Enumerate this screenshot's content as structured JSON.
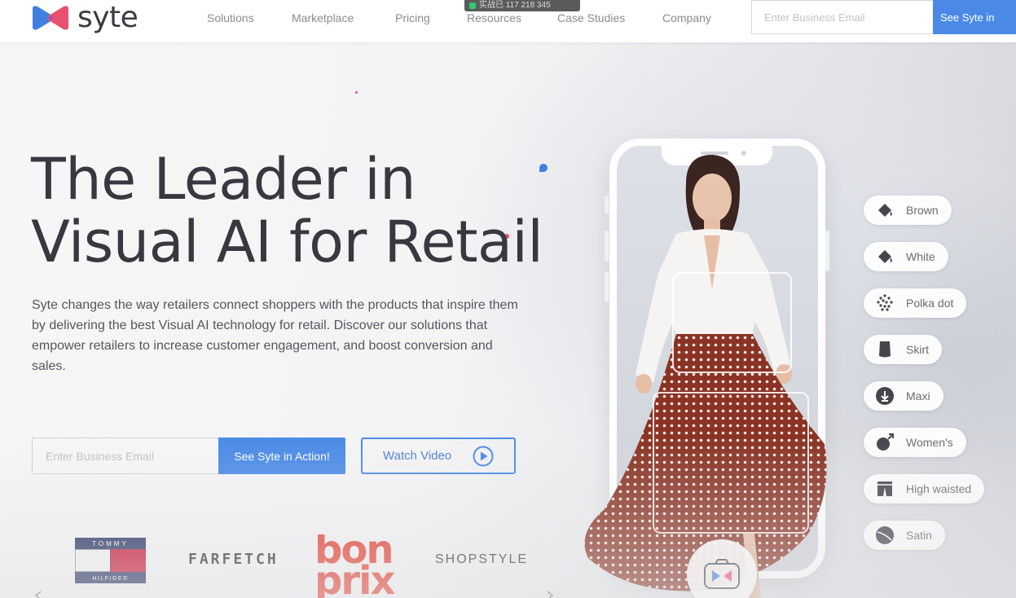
{
  "header": {
    "logo_text": "syte",
    "nav": [
      {
        "label": "Solutions"
      },
      {
        "label": "Marketplace"
      },
      {
        "label": "Pricing"
      },
      {
        "label": "Resources"
      },
      {
        "label": "Case Studies"
      },
      {
        "label": "Company"
      }
    ],
    "overlay_tooltip": "实战已 117 218 345",
    "email_placeholder": "Enter Business Email",
    "cta_label": "See Syte in"
  },
  "hero": {
    "title_line1": "The Leader in",
    "title_line2": "Visual AI for Retail",
    "description": "Syte changes the way retailers connect shoppers with the products that inspire them by delivering the best Visual AI technology for retail. Discover our solutions that empower retailers to increase customer engagement, and boost conversion and sales.",
    "email_placeholder": "Enter Business Email",
    "cta_label": "See Syte in Action!",
    "watch_label": "Watch Video"
  },
  "brands": {
    "tommy_top": "TOMMY",
    "tommy_bottom": "HILFIGER",
    "farfetch": "FARFETCH",
    "bonprix_line1": "bon",
    "bonprix_line2": "prix",
    "shopstyle": "SHOPSTYLE"
  },
  "tags": [
    {
      "label": "Brown",
      "icon": "paint-bucket-icon"
    },
    {
      "label": "White",
      "icon": "paint-bucket-icon"
    },
    {
      "label": "Polka dot",
      "icon": "polka-dot-icon"
    },
    {
      "label": "Skirt",
      "icon": "skirt-icon"
    },
    {
      "label": "Maxi",
      "icon": "maxi-download-icon"
    },
    {
      "label": "Women's",
      "icon": "female-symbol-icon"
    },
    {
      "label": "High waisted",
      "icon": "high-waist-icon"
    },
    {
      "label": "Satin",
      "icon": "satin-ball-icon"
    }
  ],
  "colors": {
    "accent": "#4a8ae6",
    "brand_pink": "#e8506f",
    "brand_blue": "#3f7fe0",
    "bonprix_red": "#e33a2c",
    "tommy_navy": "#1d2a5a",
    "tommy_red": "#c8102e"
  }
}
